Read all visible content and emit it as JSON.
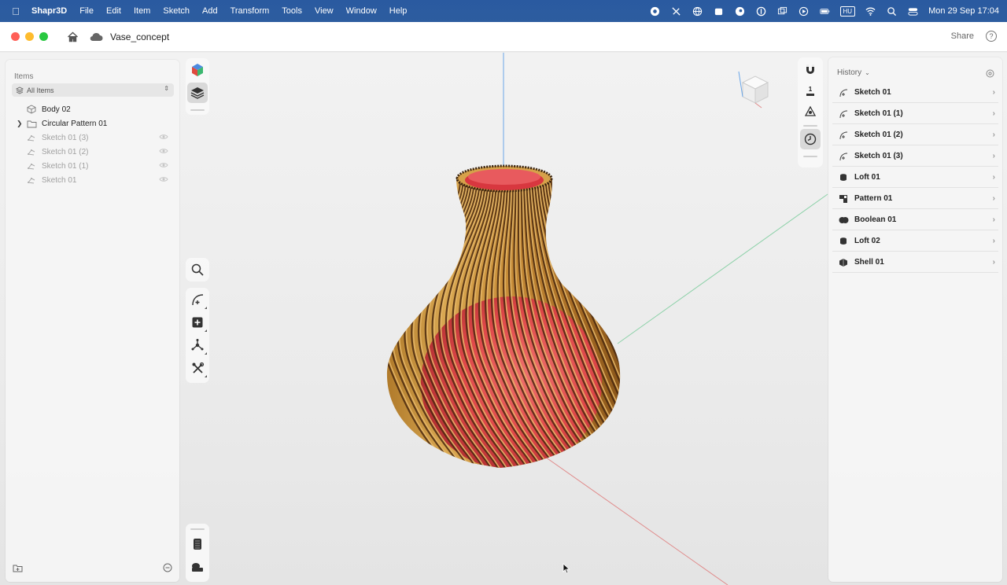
{
  "menubar": {
    "app_name": "Shapr3D",
    "menus": [
      "File",
      "Edit",
      "Item",
      "Sketch",
      "Add",
      "Transform",
      "Tools",
      "View",
      "Window",
      "Help"
    ],
    "input_source": "HU",
    "clock": "Mon 29 Sep  17:04"
  },
  "titlebar": {
    "doc_title": "Vase_concept",
    "share_label": "Share",
    "help_label": "?"
  },
  "items_panel": {
    "title": "Items",
    "filter": "All Items",
    "items": [
      {
        "label": "Body 02",
        "icon": "body-icon",
        "dim": false,
        "expandable": false
      },
      {
        "label": "Circular Pattern 01",
        "icon": "folder-icon",
        "dim": false,
        "expandable": true
      },
      {
        "label": "Sketch 01 (3)",
        "icon": "sketch-icon",
        "dim": true,
        "expandable": false
      },
      {
        "label": "Sketch 01 (2)",
        "icon": "sketch-icon",
        "dim": true,
        "expandable": false
      },
      {
        "label": "Sketch 01 (1)",
        "icon": "sketch-icon",
        "dim": true,
        "expandable": false
      },
      {
        "label": "Sketch 01",
        "icon": "sketch-icon",
        "dim": true,
        "expandable": false
      }
    ]
  },
  "right_tools": {
    "unit_label": "1"
  },
  "history_panel": {
    "title": "History",
    "items": [
      {
        "label": "Sketch 01",
        "icon": "sketch-history-icon"
      },
      {
        "label": "Sketch 01 (1)",
        "icon": "sketch-history-icon"
      },
      {
        "label": "Sketch 01 (2)",
        "icon": "sketch-history-icon"
      },
      {
        "label": "Sketch 01 (3)",
        "icon": "sketch-history-icon"
      },
      {
        "label": "Loft 01",
        "icon": "loft-icon"
      },
      {
        "label": "Pattern 01",
        "icon": "pattern-icon"
      },
      {
        "label": "Boolean 01",
        "icon": "boolean-icon"
      },
      {
        "label": "Loft 02",
        "icon": "loft-icon"
      },
      {
        "label": "Shell 01",
        "icon": "shell-icon"
      }
    ]
  },
  "colors": {
    "menubar": "#2d5d9f",
    "vase_gold": "#c8963f",
    "vase_red": "#e0444a",
    "axis_x": "#e08a8a",
    "axis_y": "#8cd1a8",
    "axis_z": "#6aa6e8"
  }
}
